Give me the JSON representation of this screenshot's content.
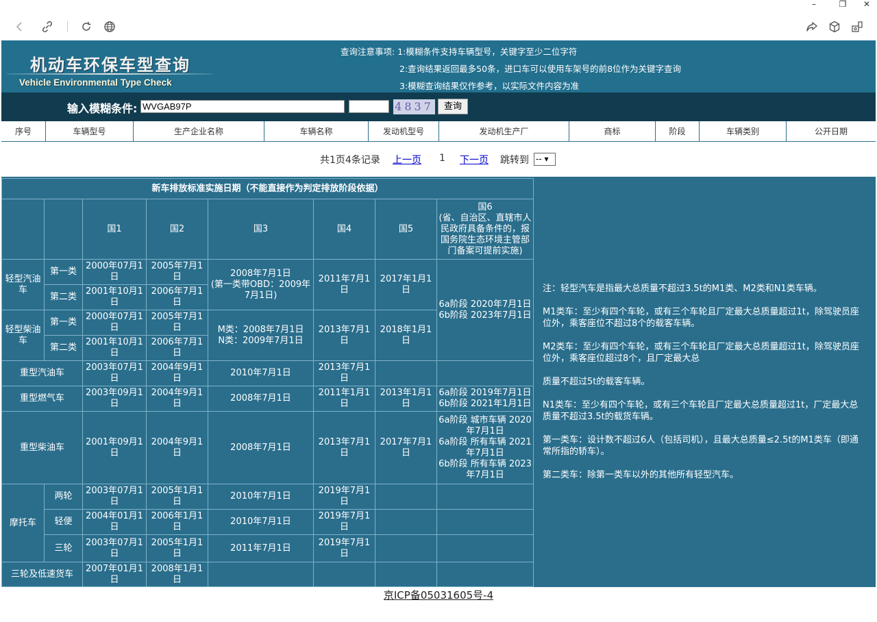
{
  "window": {
    "minimize": "–",
    "restore": "❐",
    "close": "✕"
  },
  "header": {
    "logo_cn": "机动车环保车型查询",
    "logo_en": "Vehicle Environmental Type Check",
    "notice_1": "查询注意事项: 1:模糊条件支持车辆型号，关键字至少二位字符",
    "notice_2": "2:查询结果返回最多50条，进口车可以使用车架号的前8位作为关键字查询",
    "notice_3": "3:模糊查询结果仅作参考，以实际文件内容为准"
  },
  "search": {
    "label": "输入模糊条件:",
    "value": "WVGAB97P",
    "captcha": "4837",
    "button": "查询"
  },
  "results": {
    "columns": [
      "序号",
      "车辆型号",
      "生产企业名称",
      "车辆名称",
      "发动机型号",
      "发动机生产厂",
      "商标",
      "阶段",
      "车辆类别",
      "公开日期"
    ],
    "summary": "共1页4条记录",
    "prev": "上一页",
    "page": "1",
    "next": "下一页",
    "jump_label": "跳转到",
    "jump_value": "-- ▾"
  },
  "standards": {
    "title": "新车排放标准实施日期（不能直接作为判定排放阶段依据）",
    "headers": [
      "国1",
      "国2",
      "国3",
      "国4",
      "国5"
    ],
    "guo6_header": "国6\n(省、自治区、直辖市人民政府具备条件的，报国务院生态环境主管部门备案可提前实施)",
    "light_gas": "轻型汽油车",
    "light_diesel": "轻型柴油车",
    "class1": "第一类",
    "class2": "第二类",
    "lg1": [
      "2000年07月1日",
      "2005年7月1日"
    ],
    "lg2": [
      "2001年10月1日",
      "2006年7月1日"
    ],
    "lg_g3": "2008年7月1日\n(第一类带OBD：2009年7月1日)",
    "lg_g4": "2011年7月1日",
    "lg_g5": "2017年1月1日",
    "light_g6": "6a阶段 2020年7月1日\n6b阶段 2023年7月1日",
    "ld1": [
      "2000年07月1日",
      "2005年7月1日"
    ],
    "ld2": [
      "2001年10月1日",
      "2006年7月1日"
    ],
    "ld_g3": "M类：2008年7月1日\nN类：2009年7月1日",
    "ld_g4": "2013年7月1日",
    "ld_g5": "2018年1月1日",
    "heavy_gas": {
      "name": "重型汽油车",
      "g1": "2003年07月1日",
      "g2": "2004年9月1日",
      "g3": "2010年7月1日",
      "g4": "2013年7月1日"
    },
    "heavy_ng": {
      "name": "重型燃气车",
      "g1": "2003年09月1日",
      "g2": "2004年9月1日",
      "g3": "2008年7月1日",
      "g4": "2011年1月1日",
      "g5": "2013年1月1日",
      "g6": "6a阶段 2019年7月1日\n6b阶段 2021年1月1日"
    },
    "heavy_diesel": {
      "name": "重型柴油车",
      "g1": "2001年09月1日",
      "g2": "2004年9月1日",
      "g3": "2008年7月1日",
      "g4": "2013年7月1日",
      "g5": "2017年7月1日",
      "g6": "6a阶段 城市车辆 2020年7月1日\n6a阶段 所有车辆 2021年7月1日\n6b阶段 所有车辆 2023年7月1日"
    },
    "moto": "摩托车",
    "moto_2": {
      "name": "两轮",
      "g1": "2003年07月1日",
      "g2": "2005年1月1日",
      "g3": "2010年7月1日",
      "g4": "2019年7月1日"
    },
    "moto_light": {
      "name": "轻便",
      "g1": "2004年01月1日",
      "g2": "2006年1月1日",
      "g3": "2010年7月1日",
      "g4": "2019年7月1日"
    },
    "moto_3": {
      "name": "三轮",
      "g1": "2003年07月1日",
      "g2": "2005年1月1日",
      "g3": "2011年7月1日",
      "g4": "2019年7月1日"
    },
    "tri": {
      "name": "三轮及低速货车",
      "g1": "2007年01月1日",
      "g2": "2008年1月1日"
    }
  },
  "notes": [
    "注：轻型汽车是指最大总质量不超过3.5t的M1类、M2类和N1类车辆。",
    "M1类车：至少有四个车轮，或有三个车轮且厂定最大总质量超过1t，除驾驶员座位外，乘客座位不超过8个的载客车辆。",
    "M2类车：至少有四个车轮，或有三个车轮且厂定最大总质量超过1t，除驾驶员座位外，乘客座位超过8个，且厂定最大总",
    "质量不超过5t的载客车辆。",
    "N1类车：至少有四个车轮，或有三个车轮且厂定最大总质量超过1t，厂定最大总质量不超过3.5t的载货车辆。",
    "第一类车：设计数不超过6人（包括司机），且最大总质量≤2.5t的M1类车（即通常所指的轿车）。",
    "第二类车：除第一类车以外的其他所有轻型汽车。"
  ],
  "footer": {
    "icp": "京ICP备05031605号-4"
  }
}
